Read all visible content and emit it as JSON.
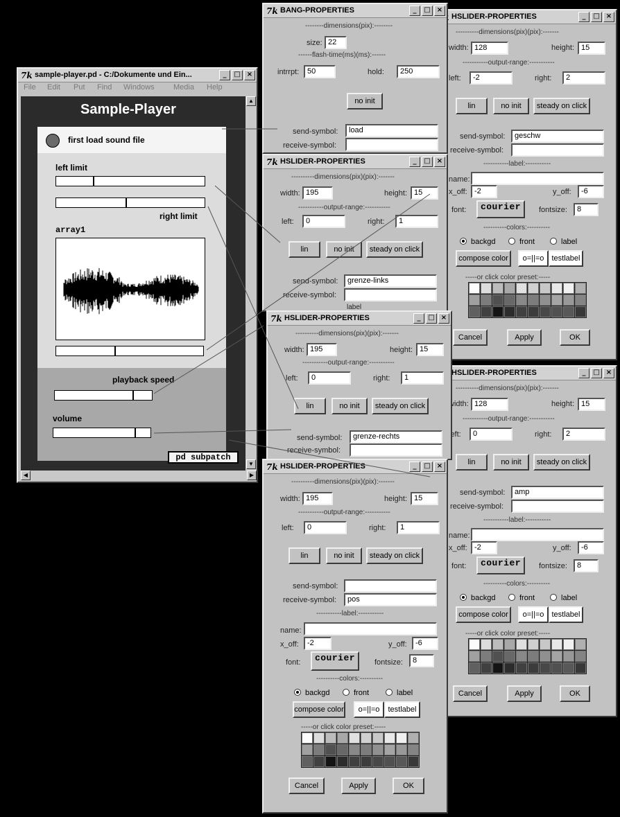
{
  "main": {
    "title": "sample-player.pd  - C:/Dokumente und Ein...",
    "menu": [
      "File",
      "Edit",
      "Put",
      "Find",
      "Windows",
      "Media",
      "Help"
    ],
    "heading": "Sample-Player",
    "bang_label": "first load sound file",
    "left_limit": "left limit",
    "right_limit": "right limit",
    "array_label": "array1",
    "speed_label": "playback speed",
    "volume_label": "volume",
    "subpatch": "pd subpatch",
    "sliders": {
      "left_limit": 0.25,
      "right_limit": 0.47,
      "position": 0.4,
      "speed": 0.81,
      "volume": 0.85
    }
  },
  "bang": {
    "title": "BANG-PROPERTIES",
    "dims": "--------dimensions(pix):--------",
    "size_label": "size:",
    "size": "22",
    "flash": "------flash-time(ms)(ms):------",
    "intrrpt_label": "intrrpt:",
    "intrrpt": "50",
    "hold_label": "hold:",
    "hold": "250",
    "no_init": "no init",
    "send_label": "send-symbol:",
    "send": "load",
    "receive_label": "receive-symbol:",
    "receive": ""
  },
  "hs1": {
    "title": "HSLIDER-PROPERTIES",
    "dims": "----------dimensions(pix)(pix):-------",
    "width_label": "width:",
    "width": "195",
    "height_label": "height:",
    "height": "15",
    "range": "-----------output-range:-----------",
    "left_label": "left:",
    "left": "0",
    "right_label": "right:",
    "right": "1",
    "lin": "lin",
    "no_init": "no init",
    "steady": "steady on click",
    "send_label": "send-symbol:",
    "send": "grenze-links",
    "receive_label": "receive-symbol:",
    "receive": "",
    "label_sec": "label"
  },
  "hs2": {
    "title": "HSLIDER-PROPERTIES",
    "dims": "----------dimensions(pix)(pix):-------",
    "width_label": "width:",
    "width": "195",
    "height_label": "height:",
    "height": "15",
    "range": "-----------output-range:-----------",
    "left_label": "left:",
    "left": "0",
    "right_label": "right:",
    "right": "1",
    "lin": "lin",
    "no_init": "no init",
    "steady": "steady on click",
    "send_label": "send-symbol:",
    "send": "grenze-rechts",
    "receive_label": "receive-symbol:",
    "receive": ""
  },
  "hs3": {
    "title": "HSLIDER-PROPERTIES",
    "dims": "----------dimensions(pix)(pix):-------",
    "width_label": "width:",
    "width": "195",
    "height_label": "height:",
    "height": "15",
    "range": "-----------output-range:-----------",
    "left_label": "left:",
    "left": "0",
    "right_label": "right:",
    "right": "1",
    "lin": "lin",
    "no_init": "no init",
    "steady": "steady on click",
    "send_label": "send-symbol:",
    "send": "",
    "receive_label": "receive-symbol:",
    "receive": "pos",
    "label_sec": "-----------label:-----------",
    "name_label": "name:",
    "name": "",
    "xoff_label": "x_off:",
    "xoff": "-2",
    "yoff_label": "y_off:",
    "yoff": "-6",
    "font_label": "font:",
    "font": "courier",
    "fontsize_label": "fontsize:",
    "fontsize": "8",
    "colors": "----------colors:----------",
    "backgd": "backgd",
    "front": "front",
    "label": "label",
    "compose": "compose color",
    "oo": "o=||=o",
    "testlabel": "testlabel",
    "preset": "-----or click color preset:-----",
    "cancel": "Cancel",
    "apply": "Apply",
    "ok": "OK"
  },
  "hs4": {
    "title": "HSLIDER-PROPERTIES",
    "dims": "----------dimensions(pix)(pix):-------",
    "width_label": "width:",
    "width": "128",
    "height_label": "height:",
    "height": "15",
    "range": "-----------output-range:-----------",
    "left_label": "left:",
    "left": "-2",
    "right_label": "right:",
    "right": "2",
    "lin": "lin",
    "no_init": "no init",
    "steady": "steady on click",
    "send_label": "send-symbol:",
    "send": "geschw",
    "receive_label": "receive-symbol:",
    "receive": "",
    "label_sec": "-----------label:-----------",
    "name_label": "name:",
    "name": "",
    "xoff_label": "x_off:",
    "xoff": "-2",
    "yoff_label": "y_off:",
    "yoff": "-6",
    "font_label": "font:",
    "font": "courier",
    "fontsize_label": "fontsize:",
    "fontsize": "8",
    "colors": "----------colors:----------",
    "backgd": "backgd",
    "front": "front",
    "label": "label",
    "compose": "compose color",
    "oo": "o=||=o",
    "testlabel": "testlabel",
    "preset": "-----or click color preset:-----",
    "cancel": "Cancel",
    "apply": "Apply",
    "ok": "OK"
  },
  "hs5": {
    "title": "HSLIDER-PROPERTIES",
    "dims": "----------dimensions(pix)(pix):-------",
    "width_label": "width:",
    "width": "128",
    "height_label": "height:",
    "height": "15",
    "range": "-----------output-range:-----------",
    "left_label": "left:",
    "left": "0",
    "right_label": "right:",
    "right": "2",
    "lin": "lin",
    "no_init": "no init",
    "steady": "steady on click",
    "send_label": "send-symbol:",
    "send": "amp",
    "receive_label": "receive-symbol:",
    "receive": "",
    "label_sec": "-----------label:-----------",
    "name_label": "name:",
    "name": "",
    "xoff_label": "x_off:",
    "xoff": "-2",
    "yoff_label": "y_off:",
    "yoff": "-6",
    "font_label": "font:",
    "font": "courier",
    "fontsize_label": "fontsize:",
    "fontsize": "8",
    "colors": "----------colors:----------",
    "backgd": "backgd",
    "front": "front",
    "label": "label",
    "compose": "compose color",
    "oo": "o=||=o",
    "testlabel": "testlabel",
    "preset": "-----or click color preset:-----",
    "cancel": "Cancel",
    "apply": "Apply",
    "ok": "OK"
  },
  "palette": [
    "#fcfcfc",
    "#dcdcdc",
    "#bcbcbc",
    "#a8a8a8",
    "#e0e0e0",
    "#d0d0d0",
    "#c8c8c8",
    "#e8e8e8",
    "#f0f0f0",
    "#b0b0b0",
    "#a0a0a0",
    "#7c7c7c",
    "#505050",
    "#686868",
    "#888888",
    "#7c7c7c",
    "#909090",
    "#a4a4a4",
    "#989898",
    "#848484",
    "#606060",
    "#404040",
    "#141414",
    "#2c2c2c",
    "#404040",
    "#3c3c3c",
    "#484848",
    "#505050",
    "#585858",
    "#383838"
  ]
}
